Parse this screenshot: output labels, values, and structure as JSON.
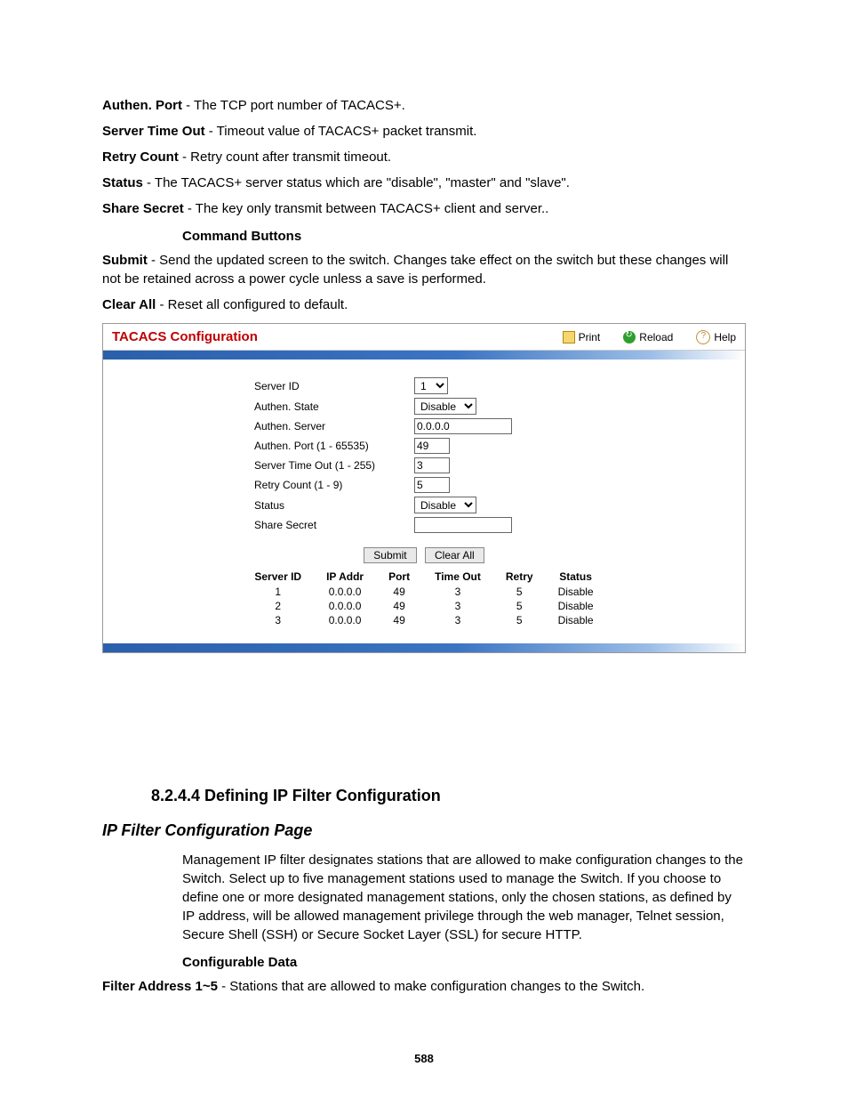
{
  "defs": {
    "authen_port_label": "Authen. Port",
    "authen_port_text": " - The TCP port number of TACACS+.",
    "server_timeout_label": "Server Time Out",
    "server_timeout_text": " - Timeout value of TACACS+ packet transmit.",
    "retry_count_label": "Retry Count",
    "retry_count_text": " - Retry count after transmit timeout.",
    "status_label": "Status",
    "status_text": " - The TACACS+ server status which are \"disable\", \"master\" and \"slave\".",
    "share_secret_label": "Share Secret",
    "share_secret_text": " - The key only transmit between TACACS+ client and server..",
    "cmd_buttons_heading": "Command Buttons",
    "submit_label": "Submit",
    "submit_text": " - Send the updated screen to the switch. Changes take effect on the switch but these changes will not be retained across a power cycle unless a save is performed.",
    "clear_all_label": "Clear All",
    "clear_all_text": " - Reset all configured to default."
  },
  "panel": {
    "title": "TACACS Configuration",
    "actions": {
      "print": "Print",
      "reload": "Reload",
      "help": "Help"
    },
    "form": {
      "server_id_label": "Server ID",
      "server_id_value": "1",
      "authen_state_label": "Authen. State",
      "authen_state_value": "Disable",
      "authen_server_label": "Authen. Server",
      "authen_server_value": "0.0.0.0",
      "authen_port_label": "Authen. Port (1 - 65535)",
      "authen_port_value": "49",
      "server_timeout_label": "Server Time Out (1 - 255)",
      "server_timeout_value": "3",
      "retry_count_label": "Retry Count (1 - 9)",
      "retry_count_value": "5",
      "status_label": "Status",
      "status_value": "Disable",
      "share_secret_label": "Share Secret",
      "share_secret_value": ""
    },
    "buttons": {
      "submit": "Submit",
      "clear_all": "Clear All"
    },
    "table": {
      "headers": {
        "server_id": "Server ID",
        "ip_addr": "IP Addr",
        "port": "Port",
        "time_out": "Time Out",
        "retry": "Retry",
        "status": "Status"
      },
      "rows": [
        {
          "id": "1",
          "ip": "0.0.0.0",
          "port": "49",
          "timeout": "3",
          "retry": "5",
          "status": "Disable"
        },
        {
          "id": "2",
          "ip": "0.0.0.0",
          "port": "49",
          "timeout": "3",
          "retry": "5",
          "status": "Disable"
        },
        {
          "id": "3",
          "ip": "0.0.0.0",
          "port": "49",
          "timeout": "3",
          "retry": "5",
          "status": "Disable"
        }
      ]
    }
  },
  "section": {
    "number_title": "8.2.4.4 Defining IP Filter Configuration",
    "subtitle": "IP Filter Configuration Page",
    "paragraph": "Management IP filter designates stations that are allowed to make configuration changes to the Switch. Select up to five management stations used to manage the Switch. If you choose to define one or more designated management stations, only the chosen stations, as defined by IP address, will be allowed management privilege through the web manager, Telnet session, Secure Shell (SSH) or Secure Socket Layer (SSL) for secure HTTP.",
    "configurable_data_heading": "Configurable Data",
    "filter_label": "Filter Address 1~5",
    "filter_text": " - Stations that are allowed to make configuration changes to the Switch."
  },
  "page_number": "588"
}
